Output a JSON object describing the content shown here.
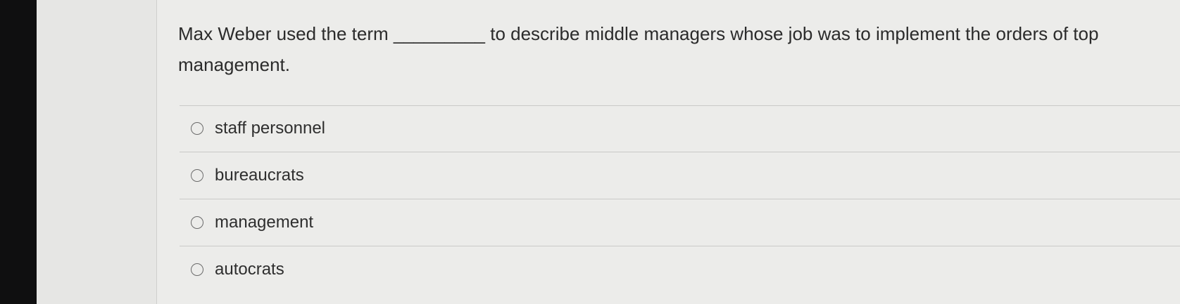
{
  "question": {
    "text": "Max Weber used the term _________ to describe middle managers whose job was to implement the orders of top management."
  },
  "options": [
    {
      "label": "staff personnel"
    },
    {
      "label": "bureaucrats"
    },
    {
      "label": "management"
    },
    {
      "label": "autocrats"
    }
  ]
}
